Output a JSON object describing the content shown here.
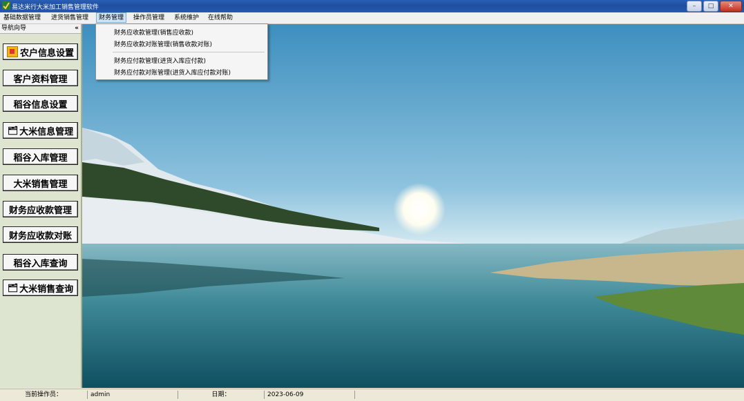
{
  "window": {
    "title": "易达米行大米加工销售管理软件",
    "controls": {
      "minimize": "–",
      "maximize": "□",
      "close": "✕"
    }
  },
  "menubar": {
    "items": [
      {
        "label": "基础数据管理"
      },
      {
        "label": "进货销售管理"
      },
      {
        "label": "财务管理",
        "active": true
      },
      {
        "label": "操作员管理"
      },
      {
        "label": "系统维护"
      },
      {
        "label": "在线帮助"
      }
    ]
  },
  "dropdown": {
    "items": [
      {
        "label": "财务应收款管理(销售应收款)"
      },
      {
        "label": "财务应收款对账管理(销售收款对账)"
      },
      {
        "label": "财务应付款管理(进货入库应付款)"
      },
      {
        "label": "财务应付款对账管理(进货入库应付款对账)"
      }
    ]
  },
  "sidebar": {
    "title": "导航向导",
    "collapse_icon": "«",
    "buttons": [
      {
        "label": "农户信息设置",
        "icon": "folder-icon"
      },
      {
        "label": "客户资料管理"
      },
      {
        "label": "稻谷信息设置"
      },
      {
        "label": "大米信息管理",
        "icon": "card-icon"
      },
      {
        "label": "稻谷入库管理"
      },
      {
        "label": "大米销售管理"
      },
      {
        "label": "财务应收款管理"
      },
      {
        "label": "财务应收款对账"
      },
      {
        "label": "稻谷入库查询"
      },
      {
        "label": "大米销售查询",
        "icon": "card-icon"
      }
    ]
  },
  "statusbar": {
    "operator_label": "当前操作员：",
    "operator_value": "admin",
    "date_label": "日期：",
    "date_value": "2023-06-09"
  },
  "colors": {
    "titlebar": "#1f4e9e",
    "sidebar_bg": "#dde4cf",
    "menu_active": "#cde5f7"
  }
}
